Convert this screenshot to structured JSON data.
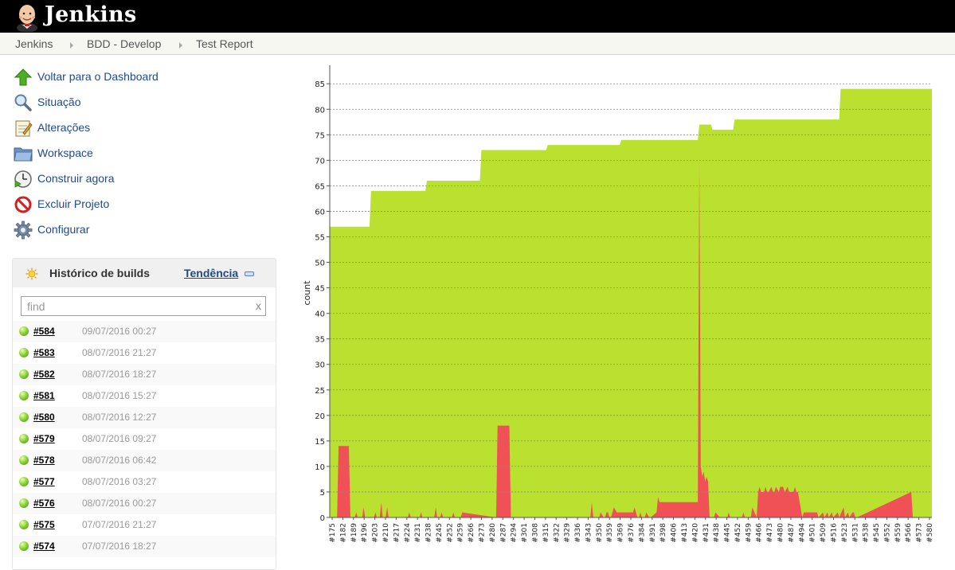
{
  "header": {
    "app_name": "Jenkins",
    "logo_icon": "jenkins-butler-icon"
  },
  "breadcrumb": [
    "Jenkins",
    "BDD - Develop",
    "Test Report"
  ],
  "side_menu": [
    {
      "label": "Voltar para o Dashboard",
      "icon": "up-arrow-icon"
    },
    {
      "label": "Situação",
      "icon": "magnifier-icon"
    },
    {
      "label": "Alterações",
      "icon": "notepad-icon"
    },
    {
      "label": "Workspace",
      "icon": "folder-icon"
    },
    {
      "label": "Construir agora",
      "icon": "clock-play-icon"
    },
    {
      "label": "Excluir Projeto",
      "icon": "no-entry-icon"
    },
    {
      "label": "Configurar",
      "icon": "gear-icon"
    }
  ],
  "build_history": {
    "title": "Histórico de builds",
    "trend_link": "Tendência",
    "search_placeholder": "find",
    "search_clear": "x",
    "builds": [
      {
        "number": "#584",
        "date": "09/07/2016 00:27"
      },
      {
        "number": "#583",
        "date": "08/07/2016 21:27"
      },
      {
        "number": "#582",
        "date": "08/07/2016 18:27"
      },
      {
        "number": "#581",
        "date": "08/07/2016 15:27"
      },
      {
        "number": "#580",
        "date": "08/07/2016 12:27"
      },
      {
        "number": "#579",
        "date": "08/07/2016 09:27"
      },
      {
        "number": "#578",
        "date": "08/07/2016 06:42"
      },
      {
        "number": "#577",
        "date": "08/07/2016 03:27"
      },
      {
        "number": "#576",
        "date": "08/07/2016 00:27"
      },
      {
        "number": "#575",
        "date": "07/07/2016 21:27"
      },
      {
        "number": "#574",
        "date": "07/07/2016 18:27"
      }
    ]
  },
  "colors": {
    "header_bg": "#000000",
    "link": "#204a87",
    "pass": "#bbe130",
    "fail": "#ef5156",
    "breadcrumb_bg": "#f7f7f1"
  },
  "chart_data": {
    "type": "area",
    "ylabel": "count",
    "ylim": [
      0,
      88
    ],
    "yticks": [
      0,
      5,
      10,
      15,
      20,
      25,
      30,
      35,
      40,
      45,
      50,
      55,
      60,
      65,
      70,
      75,
      80,
      85
    ],
    "grid": true,
    "xlim": [
      175,
      584
    ],
    "xticks": [
      "#175",
      "#182",
      "#189",
      "#196",
      "#203",
      "#210",
      "#217",
      "#224",
      "#231",
      "#238",
      "#245",
      "#252",
      "#259",
      "#266",
      "#273",
      "#280",
      "#287",
      "#294",
      "#301",
      "#308",
      "#315",
      "#322",
      "#329",
      "#336",
      "#343",
      "#350",
      "#359",
      "#369",
      "#376",
      "#384",
      "#391",
      "#398",
      "#406",
      "#413",
      "#420",
      "#431",
      "#438",
      "#445",
      "#452",
      "#459",
      "#466",
      "#473",
      "#480",
      "#487",
      "#494",
      "#501",
      "#509",
      "#516",
      "#523",
      "#531",
      "#538",
      "#545",
      "#552",
      "#559",
      "#566",
      "#573",
      "#580"
    ],
    "series": [
      {
        "color": "#bbe130",
        "x": [
          175,
          202,
          203,
          240,
          241,
          277,
          278,
          322,
          323,
          372,
          373,
          425,
          426,
          434,
          435,
          449,
          450,
          521,
          522,
          584
        ],
        "y": [
          57,
          57,
          64,
          64,
          66,
          66,
          72,
          72,
          73,
          73,
          74,
          74,
          77,
          77,
          76,
          76,
          78,
          78,
          84,
          84
        ]
      },
      {
        "color": "#ef5156",
        "x": [
          175,
          180,
          181,
          188,
          189,
          192,
          193,
          194,
          195,
          197,
          198,
          199,
          200,
          205,
          206,
          207,
          208,
          209,
          210,
          211,
          212,
          213,
          214,
          215,
          216,
          228,
          229,
          230,
          231,
          236,
          237,
          238,
          239,
          240,
          241,
          246,
          247,
          248,
          249,
          250,
          251,
          252,
          253,
          258,
          259,
          260,
          261,
          264,
          265,
          288,
          289,
          297,
          298,
          352,
          353,
          354,
          355,
          358,
          359,
          361,
          362,
          363,
          364,
          365,
          366,
          367,
          368,
          370,
          380,
          381,
          382,
          384,
          385,
          386,
          387,
          389,
          390,
          392,
          393,
          397,
          398,
          399,
          400,
          425,
          426,
          427,
          428,
          429,
          430,
          431,
          432,
          433,
          434,
          436,
          437,
          440,
          441,
          445,
          446,
          447,
          448,
          455,
          456,
          457,
          458,
          461,
          462,
          465,
          466,
          467,
          468,
          470,
          471,
          472,
          473,
          475,
          476,
          477,
          478,
          480,
          481,
          483,
          484,
          486,
          487,
          490,
          491,
          492,
          493,
          496,
          497,
          506,
          507,
          510,
          511,
          513,
          514,
          516,
          517,
          520,
          521,
          524,
          525,
          527,
          528,
          530,
          531,
          532,
          533,
          570,
          571,
          572,
          584
        ],
        "y": [
          0,
          0,
          14,
          14,
          0,
          0,
          1,
          0,
          0,
          0,
          2,
          0,
          0,
          0,
          1,
          0,
          0,
          0,
          3,
          0,
          0,
          0,
          2,
          0,
          0,
          0,
          1,
          0,
          0,
          0,
          1,
          0,
          0,
          0,
          0,
          0,
          2,
          0,
          0,
          0,
          1,
          0,
          0,
          0,
          1,
          0,
          0,
          0,
          1,
          0,
          18,
          18,
          0,
          0,
          3,
          0,
          0,
          0,
          1,
          0,
          0,
          1,
          1,
          0,
          0,
          1,
          2,
          1,
          1,
          1,
          2,
          0,
          0,
          1,
          0,
          0,
          1,
          0,
          0,
          1,
          4,
          3,
          3,
          3,
          70,
          10,
          8,
          9,
          7,
          8,
          7,
          0,
          0,
          0,
          1,
          0,
          0,
          0,
          1,
          0,
          0,
          0,
          1,
          0,
          0,
          0,
          2,
          0,
          5,
          6,
          5,
          5,
          6,
          5,
          5,
          6,
          5,
          5,
          6,
          5,
          6,
          6,
          5,
          6,
          5,
          5,
          6,
          5,
          5,
          0,
          1,
          1,
          0,
          1,
          0,
          1,
          0,
          1,
          0,
          1,
          0,
          2,
          0,
          1,
          0,
          1,
          1,
          0,
          0,
          5,
          0,
          0,
          0
        ]
      }
    ]
  }
}
